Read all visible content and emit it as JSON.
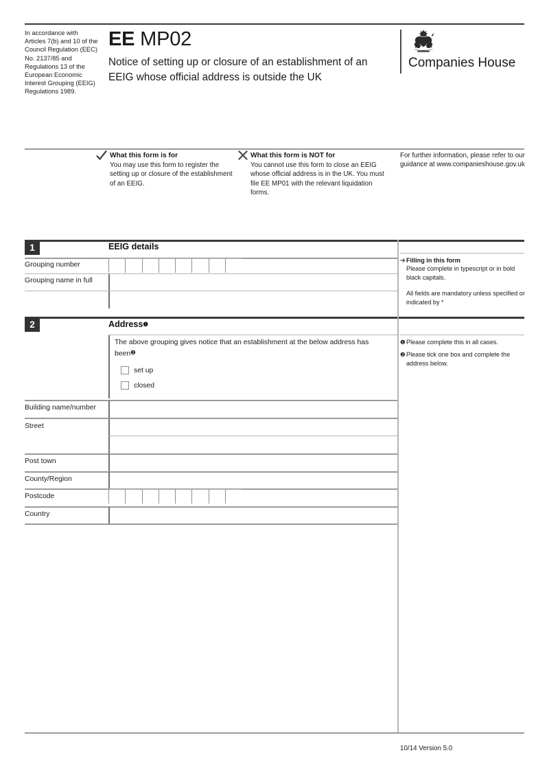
{
  "header": {
    "accordance_text": "In accordance with Articles 7(b) and 10 of the Council Regulation (EEC) No. 2137/85 and Regulations 13 of the European Economic Interest Grouping (EEIG) Regulations 1989.",
    "form_code_bold": "EE",
    "form_code_light": "MP02",
    "form_subtitle": "Notice of setting up or closure of an establishment of an EEIG whose official address is outside the UK",
    "logo_text": "Companies House",
    "logo_icon": "royal-coat-of-arms"
  },
  "guidance": {
    "for": {
      "icon": "tick-icon",
      "heading": "What this form is for",
      "body": "You may use this form to register the setting up or closure of the establishment of an EEIG."
    },
    "not_for": {
      "icon": "cross-icon",
      "heading": "What this form is NOT for",
      "body": "You cannot use this form to close an EEIG whose official address is in the UK. You must file EE MP01 with the relevant liquidation forms."
    },
    "further_info": "For further information, please refer to our guidance at www.companieshouse.gov.uk"
  },
  "section1": {
    "number": "1",
    "title": "EEIG details",
    "fields": {
      "grouping_number_label": "Grouping number",
      "grouping_number_boxes": 8,
      "grouping_name_label": "Grouping name in full"
    },
    "note": {
      "icon": "arrow-icon",
      "heading": "Filling in this form",
      "body": "Please complete in typescript or in bold black capitals.",
      "body2": "All fields are mandatory unless specified or indicated by *"
    }
  },
  "section2": {
    "number": "2",
    "title": "Address",
    "title_marker": "❶",
    "statement": "The above grouping gives notice that an establishment at the below address has been",
    "statement_marker": "❷",
    "checkboxes": [
      {
        "label": "set up",
        "checked": false
      },
      {
        "label": "closed",
        "checked": false
      }
    ],
    "address_fields": {
      "building": "Building name/number",
      "street": "Street",
      "post_town": "Post town",
      "county_region": "County/Region",
      "postcode": "Postcode",
      "postcode_boxes": 8,
      "country": "Country"
    },
    "notes": [
      {
        "marker": "❶",
        "text": "Please complete this in all cases."
      },
      {
        "marker": "❷",
        "text": "Please tick one box and complete the address below."
      }
    ]
  },
  "footer": {
    "version": "10/14 Version 5.0"
  },
  "colors": {
    "badge_bg": "#333333",
    "rule_dark": "#3a3a3a",
    "rule_light": "#b4b4b4",
    "text": "#1a1a1a"
  }
}
